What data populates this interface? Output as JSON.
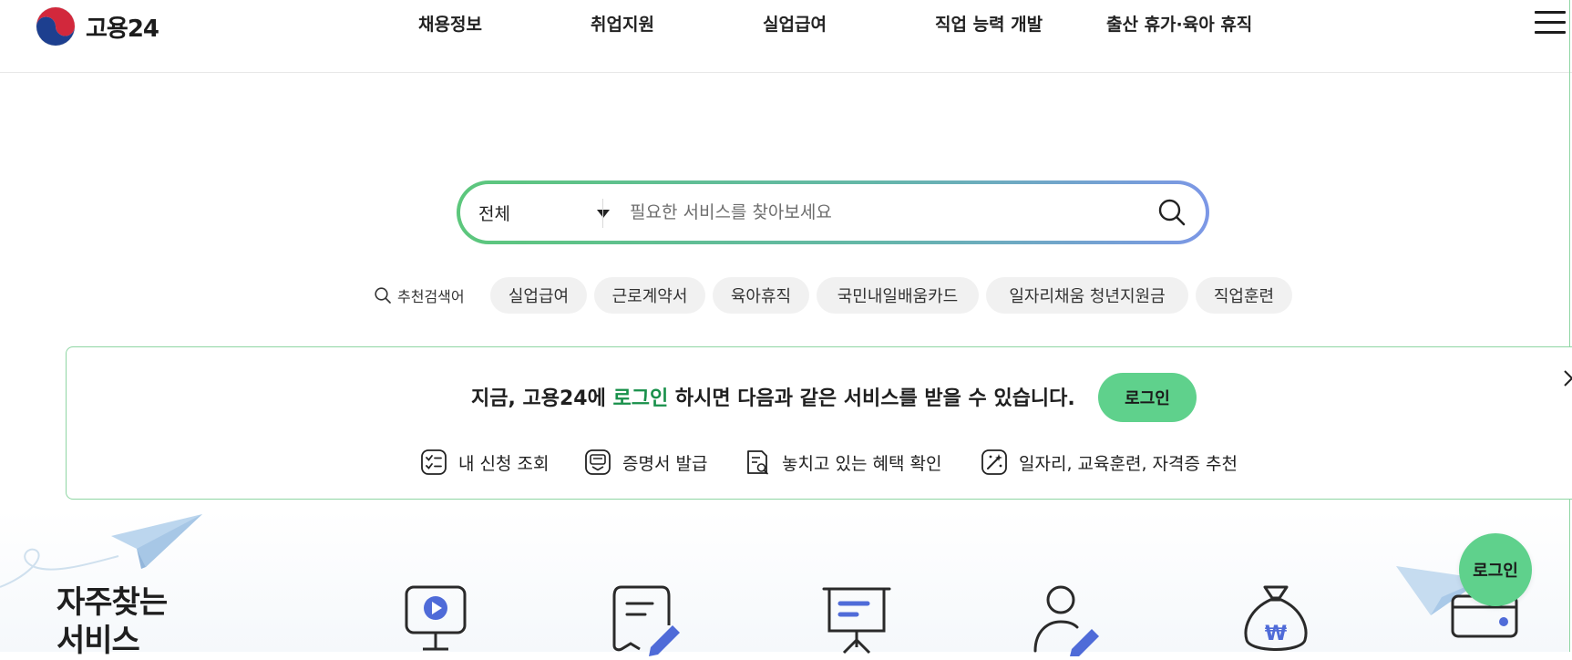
{
  "header": {
    "logo_text": "고용24",
    "nav": [
      "채용정보",
      "취업지원",
      "실업급여",
      "직업 능력 개발",
      "출산 휴가·육아 휴직"
    ]
  },
  "search": {
    "scope": "전체",
    "placeholder": "필요한 서비스를 찾아보세요",
    "value": ""
  },
  "recommended": {
    "label": "추천검색어",
    "keywords": [
      "실업급여",
      "근로계약서",
      "육아휴직",
      "국민내일배움카드",
      "일자리채움 청년지원금",
      "직업훈련"
    ]
  },
  "login_banner": {
    "message_before": "지금, 고용24에 ",
    "message_accent": "로그인",
    "message_after": " 하시면 다음과 같은 서비스를 받을 수 있습니다.",
    "login_label": "로그인",
    "services": [
      "내 신청 조회",
      "증명서 발급",
      "놓치고 있는 혜택 확인",
      "일자리, 교육훈련, 자격증 추천"
    ]
  },
  "frequent": {
    "title_line1": "자주찾는",
    "title_line2": "서비스"
  },
  "floating_login_label": "로그인",
  "colors": {
    "accent_green": "#5fd18c",
    "accent_text_green": "#18904a",
    "icon_blue": "#4f6bd8",
    "gradient_start": "#5cc77c",
    "gradient_end": "#7c97e6"
  }
}
